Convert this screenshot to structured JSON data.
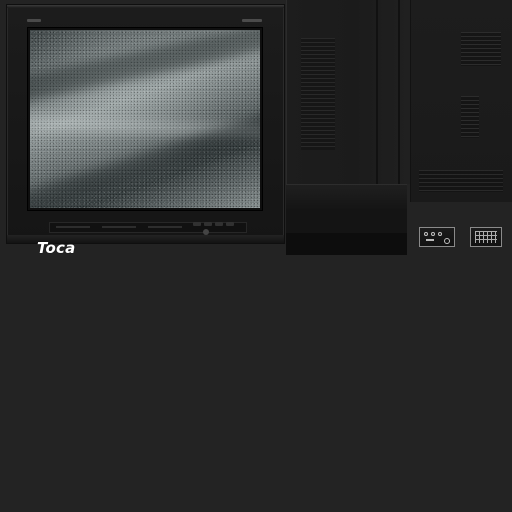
{
  "label": {
    "text": "Toca"
  },
  "colors": {
    "background": "#232323",
    "text": "#ffffff",
    "screen_tint": "#6d7b7c"
  },
  "icons": {
    "tv_brand_mark": "brand-mark-icon",
    "tv_model_mark": "model-mark-icon",
    "screen": "static-screen-icon",
    "ports_left": "connector-panel-icon",
    "ports_right": "connector-panel-icon"
  }
}
